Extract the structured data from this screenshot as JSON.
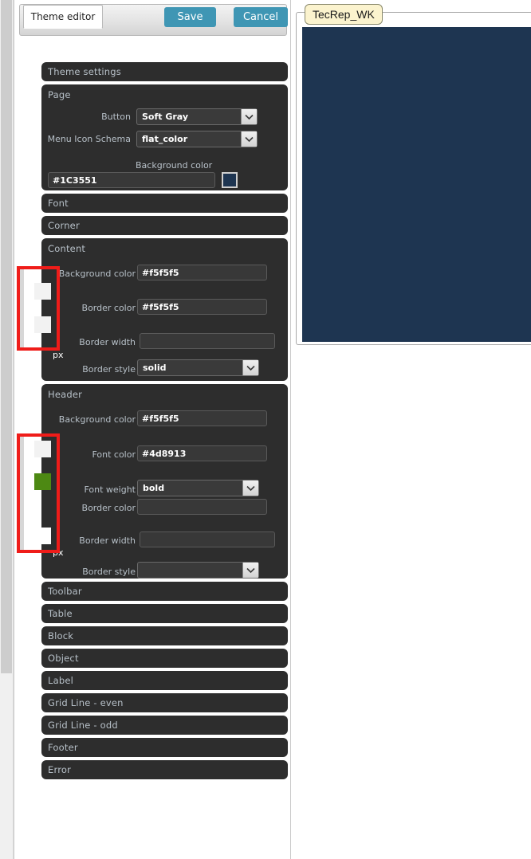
{
  "window": {
    "tab_label": "Theme editor",
    "save_label": "Save",
    "cancel_label": "Cancel"
  },
  "accordion": {
    "root_title": "Theme settings",
    "sections": {
      "page": {
        "title": "Page",
        "fields": {
          "button_label": "Button",
          "button_value": "Soft Gray",
          "menu_icon_label": "Menu Icon Schema",
          "menu_icon_value": "flat_color",
          "background_color_label": "Background color",
          "background_color_value": "#1C3551",
          "background_swatch_color": "#1e3551"
        }
      },
      "font": {
        "title": "Font"
      },
      "corner": {
        "title": "Corner"
      },
      "content": {
        "title": "Content",
        "fields": {
          "background_color_label": "Background color",
          "background_color_value": "#f5f5f5",
          "background_swatch_color": "#f2f2f2",
          "border_color_label": "Border color",
          "border_color_value": "#f5f5f5",
          "border_swatch_color": "#f2f2f2",
          "border_width_label": "Border width",
          "border_width_value": "",
          "border_width_unit": "px",
          "border_style_label": "Border style",
          "border_style_value": "solid"
        }
      },
      "header": {
        "title": "Header",
        "fields": {
          "background_color_label": "Background color",
          "background_color_value": "#f5f5f5",
          "background_swatch_color": "#f2f2f2",
          "font_color_label": "Font color",
          "font_color_value": "#4d8913",
          "font_swatch_color": "#4d8913",
          "font_weight_label": "Font weight",
          "font_weight_value": "bold",
          "border_color_label": "Border color",
          "border_color_value": "",
          "border_swatch_color": "#ffffff",
          "border_width_label": "Border width",
          "border_width_value": "",
          "border_width_unit": "px",
          "border_style_label": "Border style",
          "border_style_value": ""
        }
      },
      "toolbar": {
        "title": "Toolbar"
      },
      "table": {
        "title": "Table"
      },
      "block": {
        "title": "Block"
      },
      "object": {
        "title": "Object"
      },
      "label": {
        "title": "Label"
      },
      "grid_line_even": {
        "title": "Grid Line - even"
      },
      "grid_line_odd": {
        "title": "Grid Line - odd"
      },
      "footer": {
        "title": "Footer"
      },
      "error": {
        "title": "Error"
      }
    }
  },
  "preview": {
    "tab_label": "TecRep_WK",
    "canvas_color": "#1e3551"
  },
  "colors": {
    "accent_button": "#3f96b4",
    "panel_dark": "#2d2d2d",
    "annotation_red": "#ef1c19",
    "label_gray": "#b7c0c8",
    "preview_navy": "#1e3551",
    "header_font_green": "#4d8913"
  }
}
